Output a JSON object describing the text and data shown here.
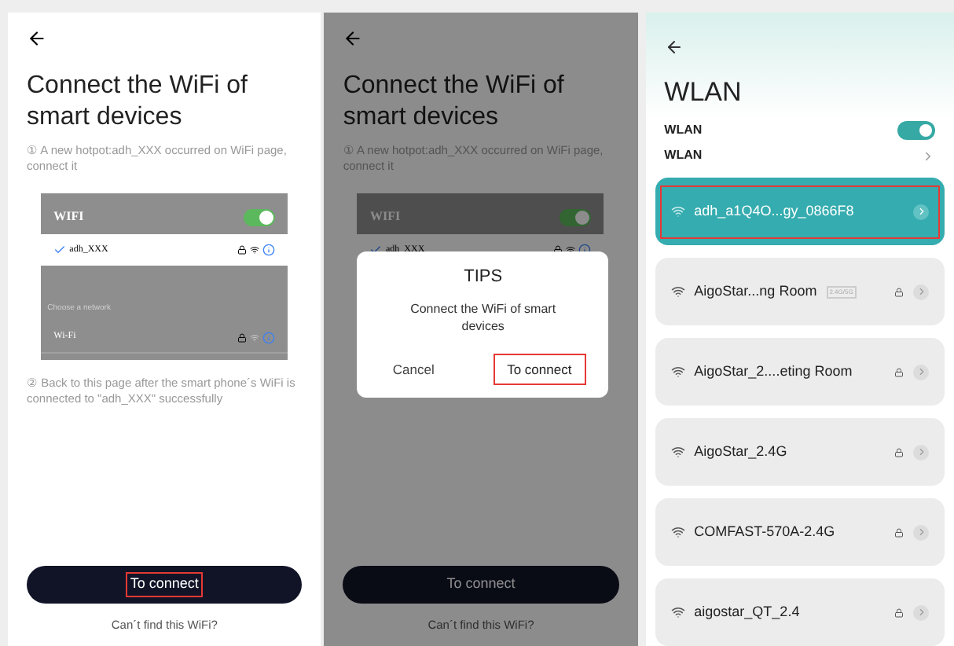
{
  "screens": [
    {
      "dimmed": false,
      "title": "Connect the WiFi of smart devices",
      "step_1": "① A new hotpot:adh_XXX occurred on WiFi page, connect it",
      "illustration": {
        "header": "WIFI",
        "toggle_on": true,
        "connected": "adh_XXX",
        "section": "Choose a network",
        "network": "Wi-Fi"
      },
      "step_2": "② Back to this page after the smart phone´s WiFi is connected to \"adh_XXX\" successfully",
      "button": {
        "label": "To connect",
        "highlighted": true
      },
      "link": "Can´t find this WiFi?"
    },
    {
      "dimmed": true,
      "title": "Connect the WiFi of smart devices",
      "step_1": "① A new hotpot:adh_XXX occurred on WiFi page, connect it",
      "illustration": {
        "header": "WIFI",
        "toggle_on": true,
        "connected": "adh_XXX"
      },
      "dialog": {
        "title": "TIPS",
        "message": "Connect the WiFi of smart devices",
        "cancel": "Cancel",
        "confirm": {
          "label": "To connect",
          "highlighted": true
        }
      },
      "button": {
        "label": "To connect",
        "highlighted": false
      },
      "link": "Can´t find this WiFi?"
    }
  ],
  "wlan": {
    "title": "WLAN",
    "toggle": {
      "label": "WLAN",
      "on": true
    },
    "settings": "WLAN",
    "networks": [
      {
        "name": "adh_a1Q4O...gy_0866F8",
        "selected": true,
        "highlighted": true,
        "locked": false
      },
      {
        "name": "AigoStar...ng Room",
        "badge": "2.4G/5G",
        "selected": false,
        "highlighted": false,
        "locked": true
      },
      {
        "name": "AigoStar_2....eting Room",
        "selected": false,
        "highlighted": false,
        "locked": true
      },
      {
        "name": "AigoStar_2.4G",
        "selected": false,
        "highlighted": false,
        "locked": true
      },
      {
        "name": "COMFAST-570A-2.4G",
        "selected": false,
        "highlighted": false,
        "locked": true
      },
      {
        "name": "aigostar_QT_2.4",
        "selected": false,
        "highlighted": false,
        "locked": true
      }
    ]
  }
}
